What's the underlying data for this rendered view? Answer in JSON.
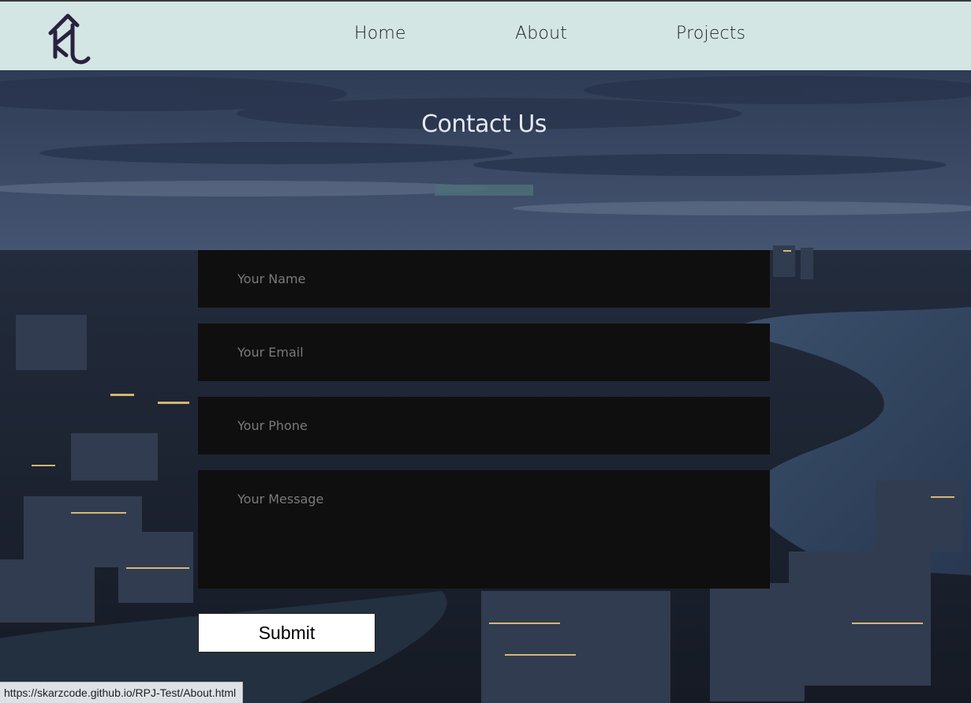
{
  "nav": {
    "logo_icon": "logo-glyph-icon",
    "links": [
      {
        "label": "Home"
      },
      {
        "label": "About"
      },
      {
        "label": "Projects"
      }
    ]
  },
  "hero": {
    "title": "Contact Us"
  },
  "form": {
    "name_placeholder": "Your Name",
    "email_placeholder": "Your Email",
    "phone_placeholder": "Your Phone",
    "message_placeholder": "Your Message",
    "submit_label": "Submit"
  },
  "status_bar": {
    "url": "https://skarzcode.github.io/RPJ-Test/About.html"
  },
  "colors": {
    "navbar_bg": "#d3e6e3",
    "field_bg": "#0f0f0f",
    "logo": "#2a2140",
    "accent_underline": "#4e6e78"
  }
}
